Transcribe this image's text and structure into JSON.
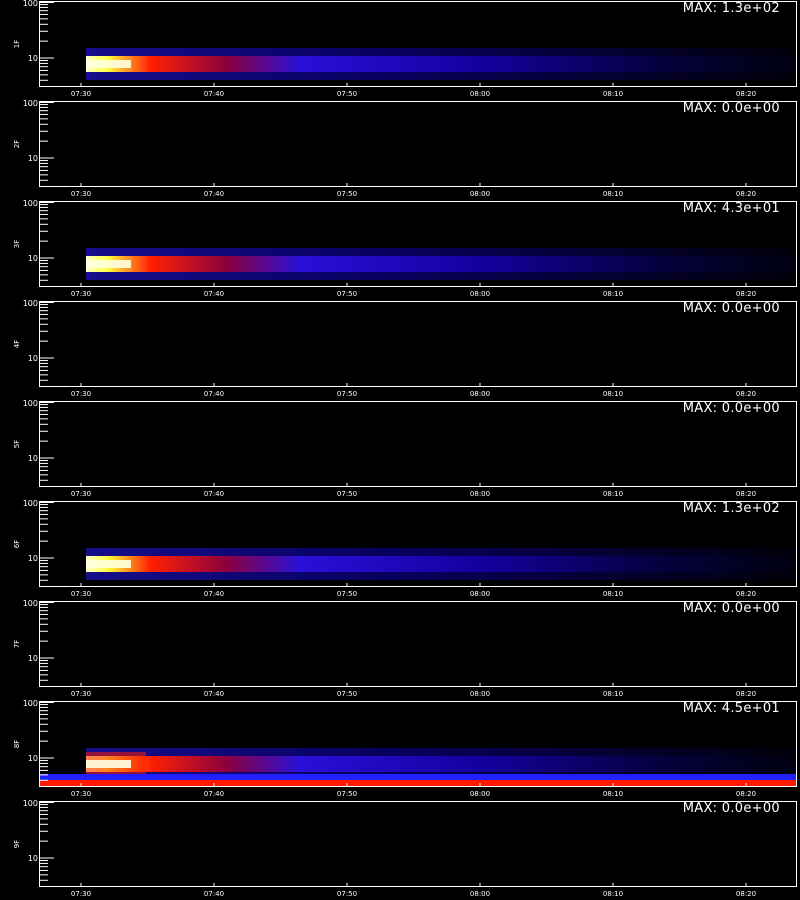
{
  "chart_data": {
    "type": "heatmap",
    "x_tick_labels": [
      "07:30",
      "07:40",
      "07:50",
      "08:00",
      "08:10",
      "08:20"
    ],
    "y_tick_labels": [
      "100",
      "10"
    ],
    "y_scale": "log",
    "colormap": [
      "#000000",
      "#0000ff",
      "#ff0000",
      "#ffff00",
      "#ffffff"
    ],
    "panels": [
      {
        "channel": "1F",
        "max_label": "MAX: 1.3e+02",
        "max": 130,
        "signal": "burst"
      },
      {
        "channel": "2F",
        "max_label": "MAX: 0.0e+00",
        "max": 0,
        "signal": "none"
      },
      {
        "channel": "3F",
        "max_label": "MAX: 4.3e+01",
        "max": 43,
        "signal": "burst"
      },
      {
        "channel": "4F",
        "max_label": "MAX: 0.0e+00",
        "max": 0,
        "signal": "none"
      },
      {
        "channel": "5F",
        "max_label": "MAX: 0.0e+00",
        "max": 0,
        "signal": "none"
      },
      {
        "channel": "6F",
        "max_label": "MAX: 1.3e+02",
        "max": 130,
        "signal": "burst"
      },
      {
        "channel": "7F",
        "max_label": "MAX: 0.0e+00",
        "max": 0,
        "signal": "none"
      },
      {
        "channel": "8F",
        "max_label": "MAX: 4.5e+01",
        "max": 45,
        "signal": "burst-band"
      },
      {
        "channel": "9F",
        "max_label": "MAX: 0.0e+00",
        "max": 0,
        "signal": "none"
      }
    ]
  }
}
